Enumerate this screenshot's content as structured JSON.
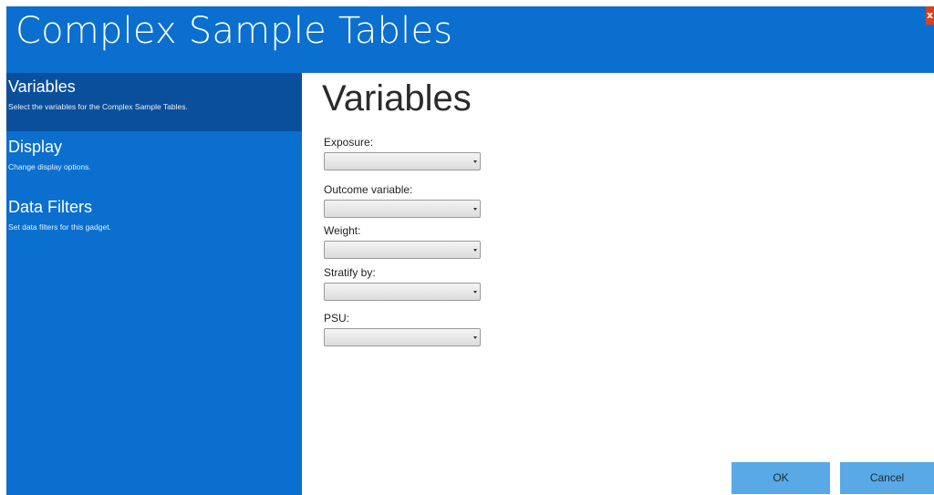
{
  "window": {
    "title": "Complex Sample Tables",
    "close_glyph": "x"
  },
  "sidebar": {
    "items": [
      {
        "label": "Variables",
        "description": "Select the variables for the Complex Sample Tables.",
        "active": true
      },
      {
        "label": "Display",
        "description": "Change display options.",
        "active": false
      },
      {
        "label": "Data Filters",
        "description": "Set data filters for this gadget.",
        "active": false
      }
    ]
  },
  "main": {
    "heading": "Variables",
    "fields": [
      {
        "label": "Exposure:",
        "value": ""
      },
      {
        "label": "Outcome variable:",
        "value": ""
      },
      {
        "label": "Weight:",
        "value": ""
      },
      {
        "label": "Stratify by:",
        "value": ""
      },
      {
        "label": "PSU:",
        "value": ""
      }
    ]
  },
  "footer": {
    "ok_label": "OK",
    "cancel_label": "Cancel"
  },
  "colors": {
    "accent": "#0a6fcf",
    "accent_active": "#0a4f9c",
    "button": "#58a9e6",
    "close": "#d9411f"
  }
}
